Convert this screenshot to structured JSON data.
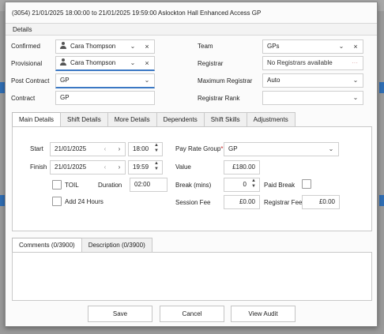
{
  "window": {
    "title": "(3054) 21/01/2025 18:00:00 to 21/01/2025 19:59:00 Aslockton Hall Enhanced Access GP"
  },
  "details": {
    "header": "Details",
    "confirmed": {
      "label": "Confirmed",
      "value": "Cara Thompson"
    },
    "provisional": {
      "label": "Provisional",
      "value": "Cara Thompson"
    },
    "post_contract": {
      "label": "Post Contract",
      "value": "GP"
    },
    "contract": {
      "label": "Contract",
      "value": "GP"
    },
    "team": {
      "label": "Team",
      "value": "GPs"
    },
    "registrar": {
      "label": "Registrar",
      "value": "No Registrars available",
      "more": "···"
    },
    "max_registrar": {
      "label": "Maximum Registrar",
      "value": "Auto"
    },
    "registrar_rank": {
      "label": "Registrar Rank",
      "value": ""
    }
  },
  "tabs": [
    "Main Details",
    "Shift Details",
    "More Details",
    "Dependents",
    "Shift Skills",
    "Adjustments"
  ],
  "main": {
    "start": {
      "label": "Start",
      "date": "21/01/2025",
      "time": "18:00"
    },
    "finish": {
      "label": "Finish",
      "date": "21/01/2025",
      "time": "19:59"
    },
    "toil": {
      "label": "TOIL"
    },
    "duration": {
      "label": "Duration",
      "value": "02:00"
    },
    "add24": {
      "label": "Add 24 Hours"
    },
    "pay_rate_group": {
      "label": "Pay Rate Group",
      "required": "*",
      "value": "GP"
    },
    "value": {
      "label": "Value",
      "value": "£180.00"
    },
    "break": {
      "label": "Break (mins)",
      "value": "0"
    },
    "paid_break": {
      "label": "Paid Break"
    },
    "session_fee": {
      "label": "Session Fee",
      "value": "£0.00"
    },
    "registrar_fee": {
      "label": "Registrar Fee",
      "value": "£0.00"
    }
  },
  "comment_tabs": [
    "Comments (0/3900)",
    "Description (0/3900)"
  ],
  "buttons": {
    "save": "Save",
    "cancel": "Cancel",
    "view_audit": "View Audit"
  },
  "icons": {
    "prev": "‹",
    "next": "›",
    "chevron": "⌄",
    "close": "×",
    "up": "▲",
    "down": "▼"
  },
  "colors": {
    "accent": "#3b78c4",
    "required": "#c62828",
    "background_blue": "#2f6db3"
  }
}
